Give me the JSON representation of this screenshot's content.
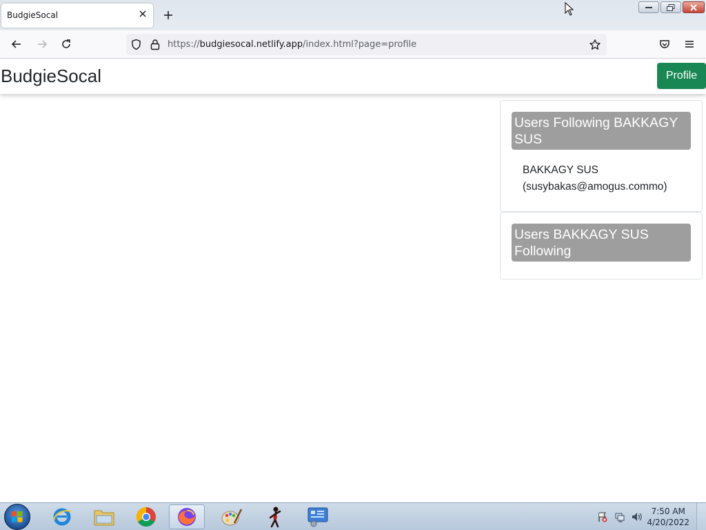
{
  "browser": {
    "tab_title": "BudgieSocal",
    "url": {
      "scheme": "https://",
      "host": "budgiesocal.netlify.app",
      "path": "/index.html?page=profile"
    }
  },
  "page": {
    "brand": "BudgieSocal",
    "profile_button": "Profile",
    "followers_card": {
      "title": "Users Following BAKKAGY SUS",
      "items": [
        {
          "name": "BAKKAGY SUS",
          "email": "(susybakas@amogus.commo)"
        }
      ]
    },
    "following_card": {
      "title": "Users BAKKAGY SUS Following",
      "items": []
    }
  },
  "taskbar": {
    "apps": [
      "internet-explorer-icon",
      "file-explorer-icon",
      "chrome-icon",
      "firefox-icon",
      "paint-icon",
      "stick-figure-app-icon",
      "control-panel-icon"
    ],
    "active_app": "firefox-icon",
    "time": "7:50 AM",
    "date": "4/20/2022"
  },
  "colors": {
    "profile_button": "#198754",
    "card_header": "#9e9e9e"
  }
}
